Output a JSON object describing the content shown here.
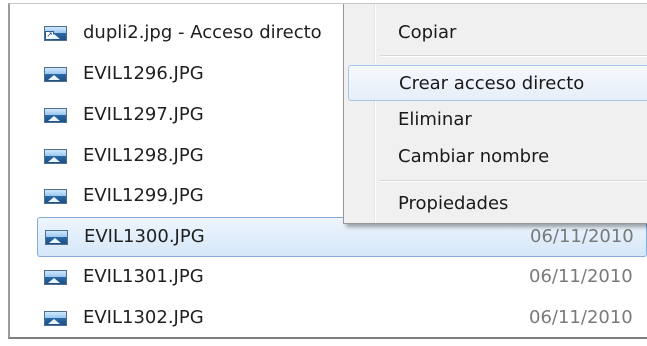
{
  "files": [
    {
      "name": "dupli2.jpg - Acceso directo",
      "date": "",
      "shortcut": true
    },
    {
      "name": "EVIL1296.JPG",
      "date": ""
    },
    {
      "name": "EVIL1297.JPG",
      "date": ""
    },
    {
      "name": "EVIL1298.JPG",
      "date": ""
    },
    {
      "name": "EVIL1299.JPG",
      "date": ""
    },
    {
      "name": "EVIL1300.JPG",
      "date": "06/11/2010",
      "selected": true
    },
    {
      "name": "EVIL1301.JPG",
      "date": "06/11/2010"
    },
    {
      "name": "EVIL1302.JPG",
      "date": "06/11/2010"
    }
  ],
  "context_menu": {
    "copy": "Copiar",
    "create_shortcut": "Crear acceso directo",
    "delete": "Eliminar",
    "rename": "Cambiar nombre",
    "properties": "Propiedades"
  },
  "icons": {
    "image_file": "image-file-icon",
    "shortcut": "shortcut-arrow-icon"
  },
  "colors": {
    "selection_border": "#84acdd",
    "menu_background": "#f0f0f0",
    "menu_hover_border": "#a8c6ea",
    "date_text": "#7a7a7a"
  }
}
